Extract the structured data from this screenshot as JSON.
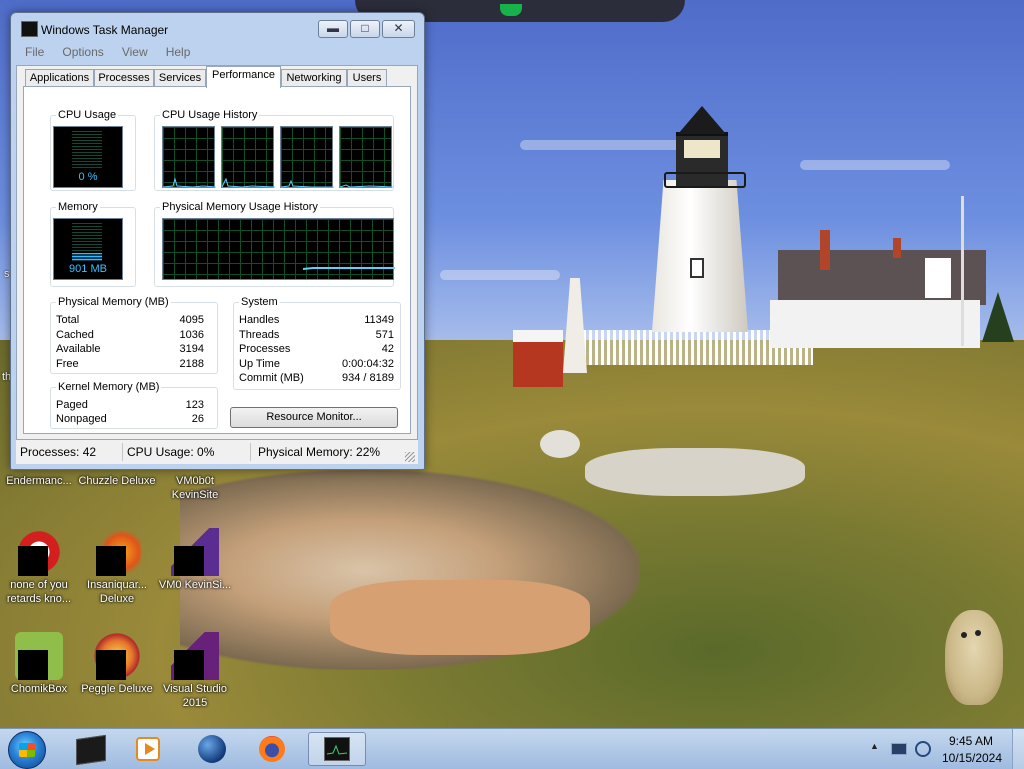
{
  "desktop": {
    "side_text_1": "s",
    "side_text_2": "th",
    "icons": [
      {
        "label": "Endermanc..."
      },
      {
        "label": "Chuzzle Deluxe"
      },
      {
        "label": "VM0b0t KevinSite"
      },
      {
        "label": "none of you retards kno..."
      },
      {
        "label": "Insaniquar... Deluxe"
      },
      {
        "label": "VM0 KevinSi..."
      },
      {
        "label": "ChomikBox"
      },
      {
        "label": "Peggle Deluxe"
      },
      {
        "label": "Visual Studio 2015"
      }
    ]
  },
  "task_manager": {
    "title": "Windows Task Manager",
    "menu": [
      "File",
      "Options",
      "View",
      "Help"
    ],
    "tabs": [
      "Applications",
      "Processes",
      "Services",
      "Performance",
      "Networking",
      "Users"
    ],
    "active_tab": "Performance",
    "cpu_usage": {
      "label": "CPU Usage",
      "value": "0 %",
      "fraction": 0.0
    },
    "cpu_history": {
      "label": "CPU Usage History"
    },
    "memory": {
      "label": "Memory",
      "value": "901 MB",
      "fraction": 0.22
    },
    "memory_history": {
      "label": "Physical Memory Usage History"
    },
    "physical_memory": {
      "title": "Physical Memory (MB)",
      "rows": [
        {
          "k": "Total",
          "v": "4095"
        },
        {
          "k": "Cached",
          "v": "1036"
        },
        {
          "k": "Available",
          "v": "3194"
        },
        {
          "k": "Free",
          "v": "2188"
        }
      ]
    },
    "kernel_memory": {
      "title": "Kernel Memory (MB)",
      "rows": [
        {
          "k": "Paged",
          "v": "123"
        },
        {
          "k": "Nonpaged",
          "v": "26"
        }
      ]
    },
    "system": {
      "title": "System",
      "rows": [
        {
          "k": "Handles",
          "v": "11349"
        },
        {
          "k": "Threads",
          "v": "571"
        },
        {
          "k": "Processes",
          "v": "42"
        },
        {
          "k": "Up Time",
          "v": "0:00:04:32"
        },
        {
          "k": "Commit (MB)",
          "v": "934 / 8189"
        }
      ]
    },
    "resource_monitor_button": "Resource Monitor...",
    "status": {
      "processes": "Processes: 42",
      "cpu": "CPU Usage: 0%",
      "memory": "Physical Memory: 22%"
    }
  },
  "taskbar": {
    "pinned": [
      {
        "icon": "terminal-icon"
      },
      {
        "icon": "media-player-icon"
      },
      {
        "icon": "globe-icon"
      },
      {
        "icon": "firefox-icon"
      },
      {
        "icon": "task-manager-icon"
      }
    ],
    "clock_time": "9:45 AM",
    "clock_date": "10/15/2024",
    "tray_arrow": "▲"
  }
}
